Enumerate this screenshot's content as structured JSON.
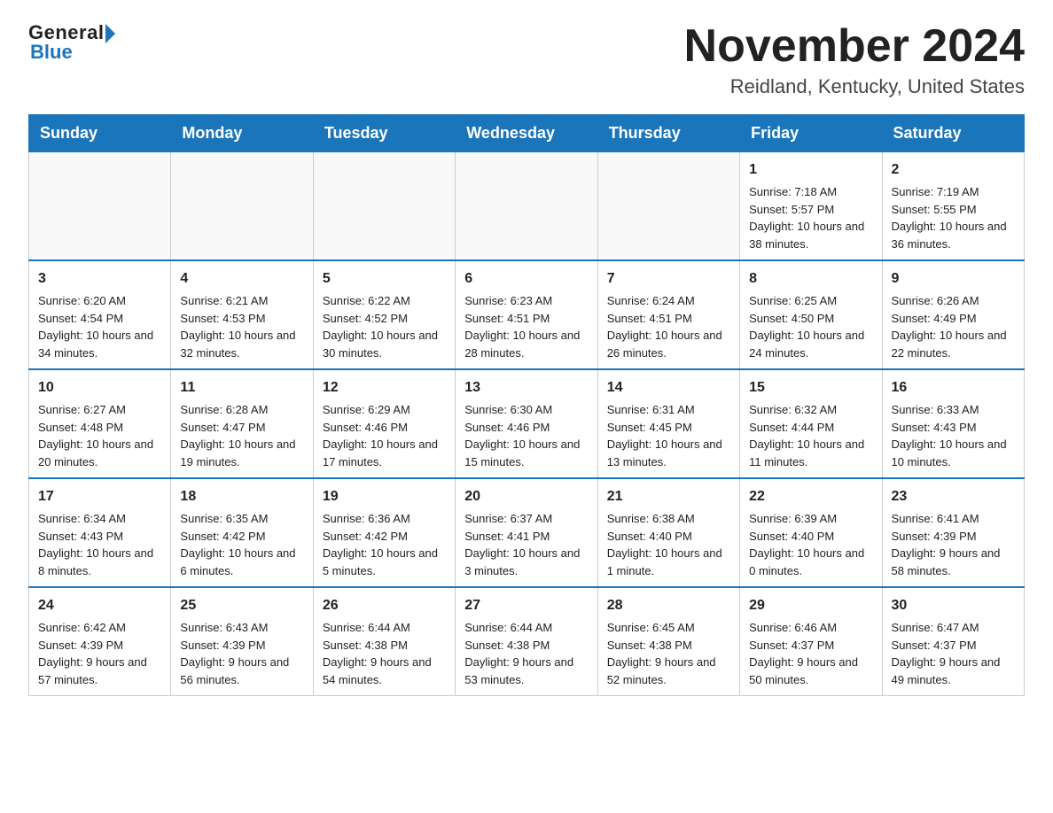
{
  "header": {
    "logo_general": "General",
    "logo_blue": "Blue",
    "month_title": "November 2024",
    "location": "Reidland, Kentucky, United States"
  },
  "weekdays": [
    "Sunday",
    "Monday",
    "Tuesday",
    "Wednesday",
    "Thursday",
    "Friday",
    "Saturday"
  ],
  "weeks": [
    [
      {
        "day": "",
        "sunrise": "",
        "sunset": "",
        "daylight": ""
      },
      {
        "day": "",
        "sunrise": "",
        "sunset": "",
        "daylight": ""
      },
      {
        "day": "",
        "sunrise": "",
        "sunset": "",
        "daylight": ""
      },
      {
        "day": "",
        "sunrise": "",
        "sunset": "",
        "daylight": ""
      },
      {
        "day": "",
        "sunrise": "",
        "sunset": "",
        "daylight": ""
      },
      {
        "day": "1",
        "sunrise": "Sunrise: 7:18 AM",
        "sunset": "Sunset: 5:57 PM",
        "daylight": "Daylight: 10 hours and 38 minutes."
      },
      {
        "day": "2",
        "sunrise": "Sunrise: 7:19 AM",
        "sunset": "Sunset: 5:55 PM",
        "daylight": "Daylight: 10 hours and 36 minutes."
      }
    ],
    [
      {
        "day": "3",
        "sunrise": "Sunrise: 6:20 AM",
        "sunset": "Sunset: 4:54 PM",
        "daylight": "Daylight: 10 hours and 34 minutes."
      },
      {
        "day": "4",
        "sunrise": "Sunrise: 6:21 AM",
        "sunset": "Sunset: 4:53 PM",
        "daylight": "Daylight: 10 hours and 32 minutes."
      },
      {
        "day": "5",
        "sunrise": "Sunrise: 6:22 AM",
        "sunset": "Sunset: 4:52 PM",
        "daylight": "Daylight: 10 hours and 30 minutes."
      },
      {
        "day": "6",
        "sunrise": "Sunrise: 6:23 AM",
        "sunset": "Sunset: 4:51 PM",
        "daylight": "Daylight: 10 hours and 28 minutes."
      },
      {
        "day": "7",
        "sunrise": "Sunrise: 6:24 AM",
        "sunset": "Sunset: 4:51 PM",
        "daylight": "Daylight: 10 hours and 26 minutes."
      },
      {
        "day": "8",
        "sunrise": "Sunrise: 6:25 AM",
        "sunset": "Sunset: 4:50 PM",
        "daylight": "Daylight: 10 hours and 24 minutes."
      },
      {
        "day": "9",
        "sunrise": "Sunrise: 6:26 AM",
        "sunset": "Sunset: 4:49 PM",
        "daylight": "Daylight: 10 hours and 22 minutes."
      }
    ],
    [
      {
        "day": "10",
        "sunrise": "Sunrise: 6:27 AM",
        "sunset": "Sunset: 4:48 PM",
        "daylight": "Daylight: 10 hours and 20 minutes."
      },
      {
        "day": "11",
        "sunrise": "Sunrise: 6:28 AM",
        "sunset": "Sunset: 4:47 PM",
        "daylight": "Daylight: 10 hours and 19 minutes."
      },
      {
        "day": "12",
        "sunrise": "Sunrise: 6:29 AM",
        "sunset": "Sunset: 4:46 PM",
        "daylight": "Daylight: 10 hours and 17 minutes."
      },
      {
        "day": "13",
        "sunrise": "Sunrise: 6:30 AM",
        "sunset": "Sunset: 4:46 PM",
        "daylight": "Daylight: 10 hours and 15 minutes."
      },
      {
        "day": "14",
        "sunrise": "Sunrise: 6:31 AM",
        "sunset": "Sunset: 4:45 PM",
        "daylight": "Daylight: 10 hours and 13 minutes."
      },
      {
        "day": "15",
        "sunrise": "Sunrise: 6:32 AM",
        "sunset": "Sunset: 4:44 PM",
        "daylight": "Daylight: 10 hours and 11 minutes."
      },
      {
        "day": "16",
        "sunrise": "Sunrise: 6:33 AM",
        "sunset": "Sunset: 4:43 PM",
        "daylight": "Daylight: 10 hours and 10 minutes."
      }
    ],
    [
      {
        "day": "17",
        "sunrise": "Sunrise: 6:34 AM",
        "sunset": "Sunset: 4:43 PM",
        "daylight": "Daylight: 10 hours and 8 minutes."
      },
      {
        "day": "18",
        "sunrise": "Sunrise: 6:35 AM",
        "sunset": "Sunset: 4:42 PM",
        "daylight": "Daylight: 10 hours and 6 minutes."
      },
      {
        "day": "19",
        "sunrise": "Sunrise: 6:36 AM",
        "sunset": "Sunset: 4:42 PM",
        "daylight": "Daylight: 10 hours and 5 minutes."
      },
      {
        "day": "20",
        "sunrise": "Sunrise: 6:37 AM",
        "sunset": "Sunset: 4:41 PM",
        "daylight": "Daylight: 10 hours and 3 minutes."
      },
      {
        "day": "21",
        "sunrise": "Sunrise: 6:38 AM",
        "sunset": "Sunset: 4:40 PM",
        "daylight": "Daylight: 10 hours and 1 minute."
      },
      {
        "day": "22",
        "sunrise": "Sunrise: 6:39 AM",
        "sunset": "Sunset: 4:40 PM",
        "daylight": "Daylight: 10 hours and 0 minutes."
      },
      {
        "day": "23",
        "sunrise": "Sunrise: 6:41 AM",
        "sunset": "Sunset: 4:39 PM",
        "daylight": "Daylight: 9 hours and 58 minutes."
      }
    ],
    [
      {
        "day": "24",
        "sunrise": "Sunrise: 6:42 AM",
        "sunset": "Sunset: 4:39 PM",
        "daylight": "Daylight: 9 hours and 57 minutes."
      },
      {
        "day": "25",
        "sunrise": "Sunrise: 6:43 AM",
        "sunset": "Sunset: 4:39 PM",
        "daylight": "Daylight: 9 hours and 56 minutes."
      },
      {
        "day": "26",
        "sunrise": "Sunrise: 6:44 AM",
        "sunset": "Sunset: 4:38 PM",
        "daylight": "Daylight: 9 hours and 54 minutes."
      },
      {
        "day": "27",
        "sunrise": "Sunrise: 6:44 AM",
        "sunset": "Sunset: 4:38 PM",
        "daylight": "Daylight: 9 hours and 53 minutes."
      },
      {
        "day": "28",
        "sunrise": "Sunrise: 6:45 AM",
        "sunset": "Sunset: 4:38 PM",
        "daylight": "Daylight: 9 hours and 52 minutes."
      },
      {
        "day": "29",
        "sunrise": "Sunrise: 6:46 AM",
        "sunset": "Sunset: 4:37 PM",
        "daylight": "Daylight: 9 hours and 50 minutes."
      },
      {
        "day": "30",
        "sunrise": "Sunrise: 6:47 AM",
        "sunset": "Sunset: 4:37 PM",
        "daylight": "Daylight: 9 hours and 49 minutes."
      }
    ]
  ]
}
